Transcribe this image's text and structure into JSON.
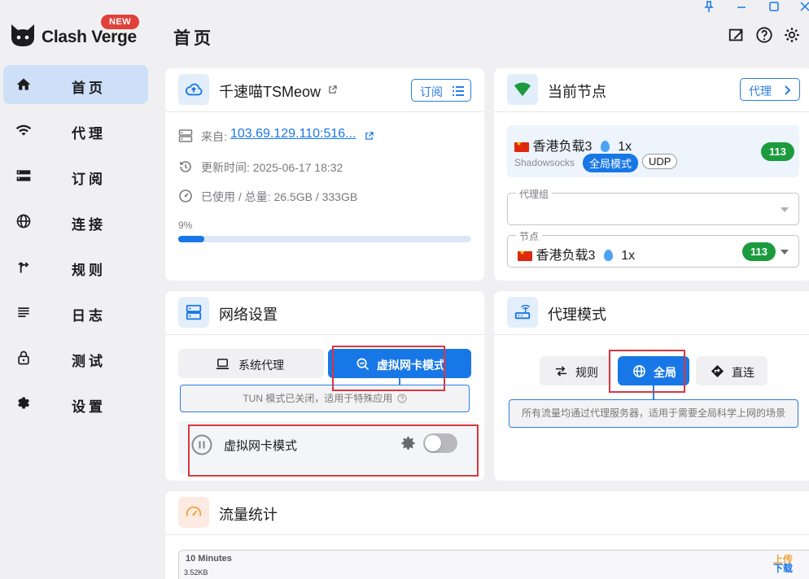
{
  "app": {
    "name": "Clash Verge",
    "badge": "NEW"
  },
  "sidebar": {
    "items": [
      {
        "label": "首页",
        "icon": "home-icon",
        "active": true
      },
      {
        "label": "代理",
        "icon": "wifi-icon",
        "active": false
      },
      {
        "label": "订阅",
        "icon": "storage-icon",
        "active": false
      },
      {
        "label": "连接",
        "icon": "globe-icon",
        "active": false
      },
      {
        "label": "规则",
        "icon": "fork-icon",
        "active": false
      },
      {
        "label": "日志",
        "icon": "list-icon",
        "active": false
      },
      {
        "label": "测试",
        "icon": "lock-icon",
        "active": false
      },
      {
        "label": "设置",
        "icon": "gear-icon",
        "active": false
      }
    ]
  },
  "header": {
    "title": "首页"
  },
  "subscription": {
    "title": "千速喵TSMeow",
    "button_label": "订阅",
    "source_label": "来自:",
    "source_value": "103.69.129.110:516...",
    "updated": "更新时间: 2025-06-17 18:32",
    "usage": "已使用 / 总量: 26.5GB / 333GB",
    "percent_label": "9%",
    "percent": 0.09
  },
  "current_node": {
    "title": "当前节点",
    "button_label": "代理",
    "node_name": "香港负载3",
    "node_rate": "1x",
    "protocol": "Shadowsocks",
    "mode_tag": "全局模式",
    "udp_tag": "UDP",
    "latency": "113",
    "group_label": "代理组",
    "node_label": "节点",
    "node_select_name": "香港负载3",
    "node_select_rate": "1x",
    "node_select_latency": "113"
  },
  "network": {
    "title": "网络设置",
    "system_proxy_label": "系统代理",
    "tun_label": "虚拟网卡模式",
    "hint": "TUN 模式已关闭，适用于特殊应用",
    "row_label": "虚拟网卡模式",
    "tun_enabled": false
  },
  "proxy_mode": {
    "title": "代理模式",
    "rule_label": "规则",
    "global_label": "全局",
    "direct_label": "直连",
    "hint": "所有流量均通过代理服务器，适用于需要全局科学上网的场景"
  },
  "traffic": {
    "title": "流量统计",
    "range_label": "10 Minutes",
    "y_max": "3.52KB",
    "upload_legend": "上传",
    "download_legend": "下载"
  },
  "colors": {
    "accent": "#1877e6",
    "upload": "#f0a33a",
    "download": "#1877e6",
    "latency": "#1c9b3e",
    "annotation": "#d9363e"
  }
}
